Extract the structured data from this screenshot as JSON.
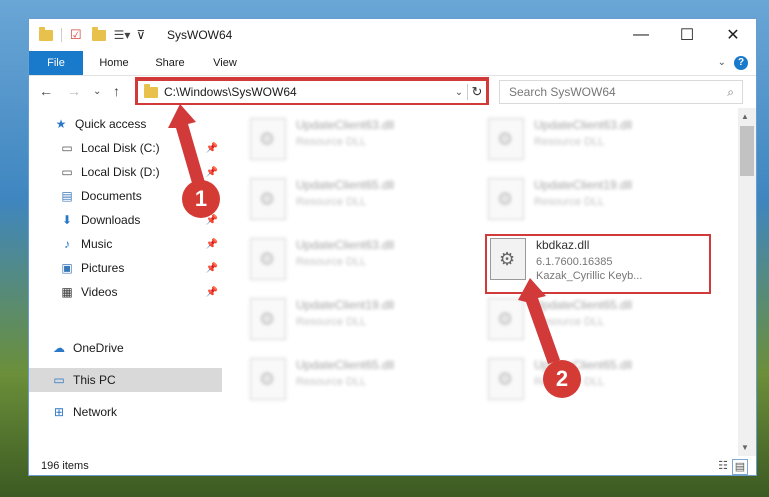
{
  "window": {
    "title": "SysWOW64"
  },
  "window_controls": {
    "minimize": "—",
    "maximize": "☐",
    "close": "✕"
  },
  "ribbon": {
    "tabs": [
      {
        "label": "File"
      },
      {
        "label": "Home"
      },
      {
        "label": "Share"
      },
      {
        "label": "View"
      }
    ],
    "help": "?"
  },
  "navbar": {
    "address": "C:\\Windows\\SysWOW64",
    "search_placeholder": "Search SysWOW64"
  },
  "sidebar": {
    "items": [
      {
        "label": "Quick access",
        "icon": "star-icon"
      },
      {
        "label": "Local Disk (C:)",
        "icon": "drive-icon",
        "pinned": true
      },
      {
        "label": "Local Disk (D:)",
        "icon": "drive-icon",
        "pinned": true
      },
      {
        "label": "Documents",
        "icon": "documents-icon",
        "pinned": true
      },
      {
        "label": "Downloads",
        "icon": "download-icon",
        "pinned": true
      },
      {
        "label": "Music",
        "icon": "music-icon",
        "pinned": true
      },
      {
        "label": "Pictures",
        "icon": "pictures-icon",
        "pinned": true
      },
      {
        "label": "Videos",
        "icon": "videos-icon",
        "pinned": true
      },
      {
        "label": "OneDrive",
        "icon": "cloud-icon"
      },
      {
        "label": "This PC",
        "icon": "computer-icon",
        "selected": true
      },
      {
        "label": "Network",
        "icon": "network-icon"
      }
    ]
  },
  "files": [
    {
      "name": "UpdateClient63.dll",
      "type": "Resource DLL"
    },
    {
      "name": "UpdateClient63.dll",
      "type": "Resource DLL"
    },
    {
      "name": "UpdateClient65.dll",
      "type": "Resource DLL"
    },
    {
      "name": "UpdateClient19.dll",
      "type": "Resource DLL"
    },
    {
      "name": "UpdateClient63.dll",
      "type": "Resource DLL"
    },
    {
      "name": "kbdkaz.dll",
      "version": "6.1.7600.16385",
      "description": "Kazak_Cyrillic Keyb..."
    },
    {
      "name": "UpdateClient19.dll",
      "type": "Resource DLL"
    },
    {
      "name": "UpdateClient65.dll",
      "type": "Resource DLL"
    },
    {
      "name": "UpdateClient65.dll",
      "type": "Resource DLL"
    },
    {
      "name": "UpdateClient65.dll",
      "type": "Resource DLL"
    }
  ],
  "status": {
    "item_count": "196 items"
  },
  "annotations": {
    "step1": "1",
    "step2": "2"
  },
  "colors": {
    "accent": "#1979ca",
    "highlight": "#d23a3a"
  }
}
